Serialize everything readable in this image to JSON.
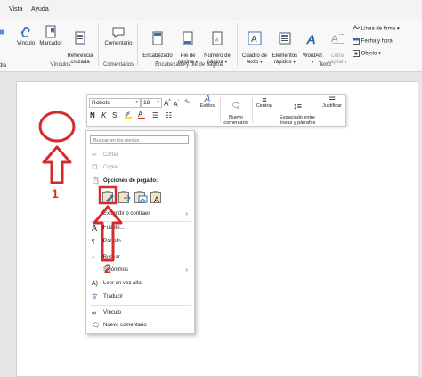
{
  "menubar": {
    "tabs": [
      "Vista",
      "Ayuda"
    ]
  },
  "ribbon": {
    "left_cut": "dia",
    "buttons": [
      {
        "label": "Vínculo"
      },
      {
        "label": "Marcador"
      },
      {
        "label": "Referencia\ncruzada"
      },
      {
        "label": "Comentario"
      },
      {
        "label": "Encabezado\n▾"
      },
      {
        "label": "Pie de\npágina ▾"
      },
      {
        "label": "Número de\npágina ▾"
      },
      {
        "label": "Cuadro de\ntexto ▾"
      },
      {
        "label": "Elementos\nrápidos ▾"
      },
      {
        "label": "WordArt\n▾"
      },
      {
        "label": "Letra\ncapital ▾"
      }
    ],
    "small_items": [
      "Línea de firma ▾",
      "Fecha y hora",
      "Objeto ▾"
    ],
    "groups": [
      "Vínculos",
      "Comentarios",
      "Encabezado y pie de página",
      "Texto"
    ]
  },
  "mini_toolbar": {
    "font": "Roboto",
    "size": "18",
    "styles_label": "Estilos",
    "new_comment": "Nuevo\ncomentario",
    "center": "Centrar",
    "spacing": "Espaciado entre\nlíneas y párrafos",
    "justify": "Justificar"
  },
  "context_menu": {
    "search_placeholder": "Buscar en los menús",
    "cut": "Cortar",
    "copy": "Copiar",
    "paste_options": "Opciones de pegado:",
    "expand": "Expandir o contraer",
    "font": "Fuente...",
    "paragraph": "Párrafo...",
    "search": "Buscar",
    "synonyms": "Sinónimos",
    "read_aloud": "Leer en voz alta",
    "translate": "Traducir",
    "link": "Vínculo",
    "new_comment": "Nuevo comentario"
  },
  "annotations": {
    "step1": "1",
    "step2": "2",
    "color": "#d42b2b"
  }
}
